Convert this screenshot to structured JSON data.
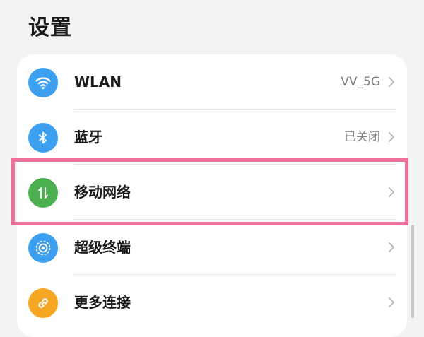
{
  "header": {
    "title": "设置"
  },
  "settings": {
    "items": [
      {
        "id": "wlan",
        "label": "WLAN",
        "value": "VV_5G",
        "icon": "wifi-icon",
        "icon_color": "#3d9ff0"
      },
      {
        "id": "bluetooth",
        "label": "蓝牙",
        "value": "已关闭",
        "icon": "bluetooth-icon",
        "icon_color": "#3d9ff0"
      },
      {
        "id": "mobile-network",
        "label": "移动网络",
        "value": "",
        "icon": "mobile-data-icon",
        "icon_color": "#4cb050"
      },
      {
        "id": "super-device",
        "label": "超级终端",
        "value": "",
        "icon": "super-device-icon",
        "icon_color": "#3d9ff0"
      },
      {
        "id": "more-connections",
        "label": "更多连接",
        "value": "",
        "icon": "link-icon",
        "icon_color": "#f5a623"
      }
    ]
  },
  "highlight": {
    "target": "mobile-network",
    "color": "#f0709a"
  }
}
